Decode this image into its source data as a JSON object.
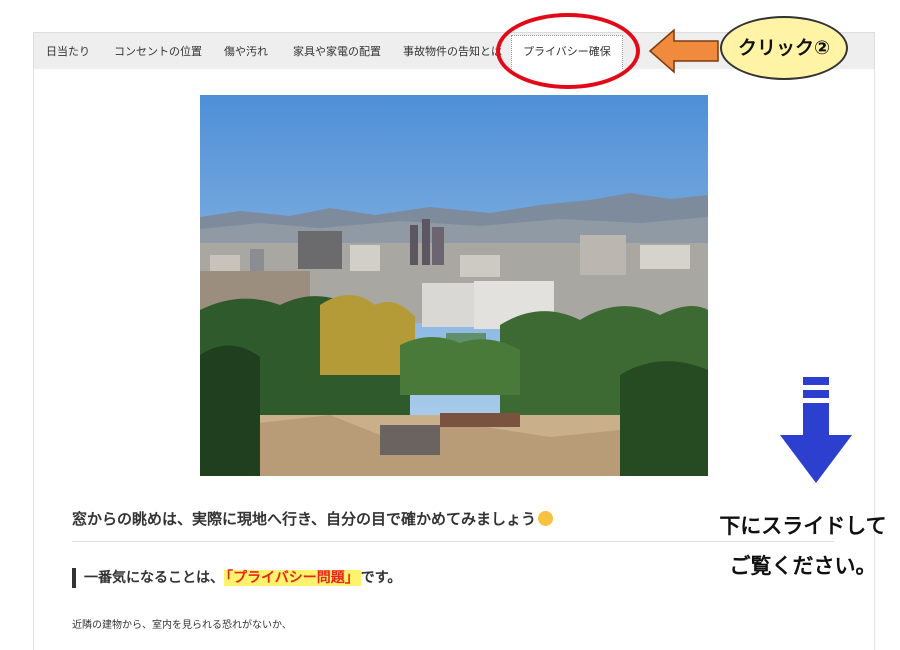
{
  "tabs": [
    {
      "label": "日当たり"
    },
    {
      "label": "コンセントの位置"
    },
    {
      "label": "傷や汚れ"
    },
    {
      "label": "家具や家電の配置"
    },
    {
      "label": "事故物件の告知とは"
    },
    {
      "label": "プライバシー確保",
      "active": true
    }
  ],
  "article": {
    "lead": "窓からの眺めは、実際に現地へ行き、自分の目で確かめてみましょう",
    "heading_prefix": "一番気になることは、",
    "heading_highlight": "「プライバシー問題」",
    "heading_suffix": "です。",
    "body_line": "近隣の建物から、室内を見られる恐れがないか、"
  },
  "annotations": {
    "click_label": "クリック②",
    "scroll_note_line1": "下にスライドして",
    "scroll_note_line2": "ご覧ください。"
  },
  "colors": {
    "highlight_ellipse": "#e30a17",
    "arrow_orange": "#f08a3c",
    "arrow_blue": "#2d3fcf",
    "badge_fill": "#fff3a6",
    "heading_highlight_text": "#e8251e",
    "heading_highlight_bg": "#fff36b"
  },
  "icons": {
    "lead_emoji": "relieved-face-icon"
  }
}
